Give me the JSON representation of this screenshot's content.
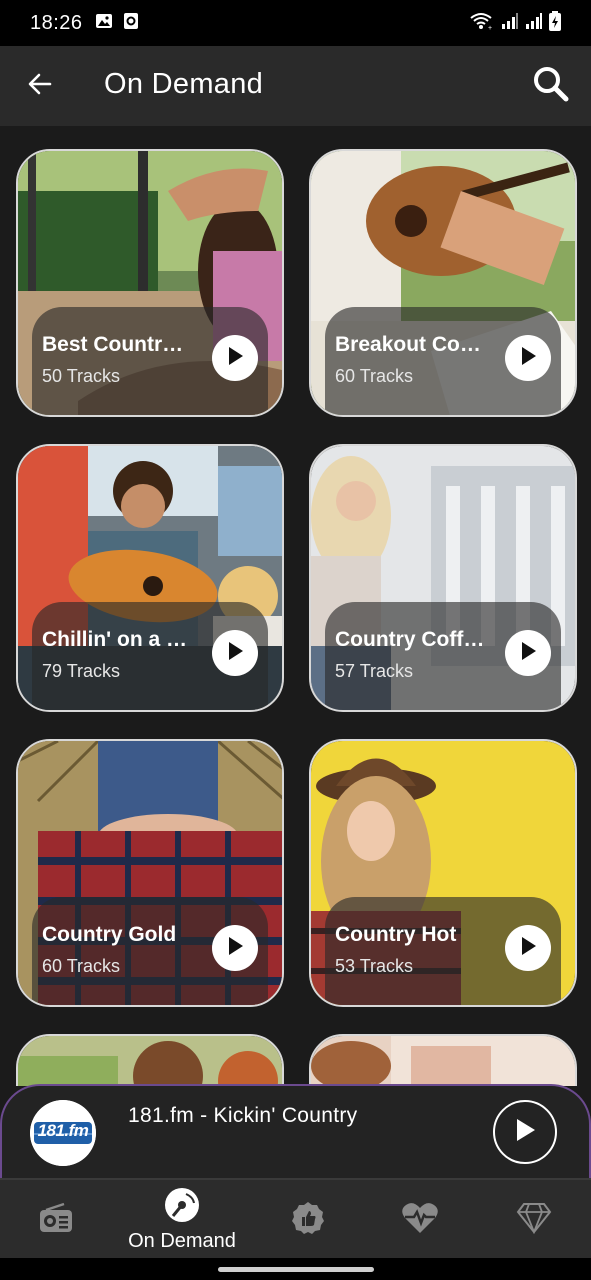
{
  "status_bar": {
    "time": "18:26"
  },
  "app_bar": {
    "title": "On Demand"
  },
  "cards": [
    {
      "title": "Best Country ...",
      "tracks": "50 Tracks"
    },
    {
      "title": "Breakout Cou...",
      "tracks": "60 Tracks"
    },
    {
      "title": "Chillin' on a Di...",
      "tracks": "79 Tracks"
    },
    {
      "title": "Country Coffe...",
      "tracks": "57 Tracks"
    },
    {
      "title": "Country Gold",
      "tracks": "60 Tracks"
    },
    {
      "title": "Country Hot",
      "tracks": "53 Tracks"
    }
  ],
  "mini_player": {
    "station": "181.fm - Kickin' Country",
    "logo_text": "181.fm"
  },
  "bottom_nav": {
    "active_label": "On Demand"
  },
  "colors": {
    "accent_border": "#6b4a8f",
    "background": "#1b1b1b",
    "appbar": "#2a2a2a"
  }
}
